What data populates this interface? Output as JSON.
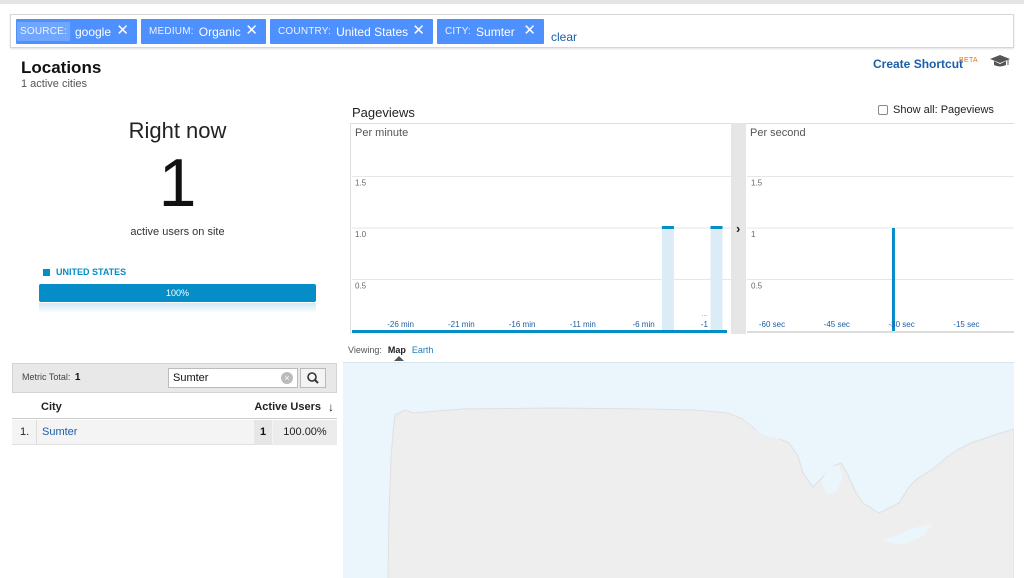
{
  "filters": {
    "chips": [
      {
        "key": "SOURCE:",
        "value": "google"
      },
      {
        "key": "MEDIUM:",
        "value": "Organic"
      },
      {
        "key": "COUNTRY:",
        "value": "United States"
      },
      {
        "key": "CITY:",
        "value": "Sumter"
      }
    ],
    "close_glyph": "✕",
    "clear_label": "clear"
  },
  "header": {
    "title": "Locations",
    "subtitle": "1 active cities",
    "shortcut_label": "Create Shortcut",
    "beta_label": "BETA",
    "cap_icon": "graduation-cap-icon"
  },
  "right_now": {
    "label": "Right now",
    "value": "1",
    "caption": "active users on site",
    "country": "UNITED STATES",
    "country_share_label": "100%",
    "country_share": 1.0
  },
  "pageviews": {
    "title": "Pageviews",
    "show_all_label": "Show all: Pageviews",
    "toggle_glyph": "›",
    "per_minute": {
      "label": "Per minute",
      "y_ticks": [
        "1.5",
        "1.0",
        "0.5"
      ],
      "x_ticks": [
        "-26 min",
        "-21 min",
        "-16 min",
        "-11 min",
        "-6 min",
        "-1"
      ],
      "overflow_marker": "...",
      "bars": [
        {
          "minute": -4,
          "value": 1
        },
        {
          "minute": 0,
          "value": 1
        }
      ]
    },
    "per_second": {
      "label": "Per second",
      "y_ticks": [
        "1.5",
        "1",
        "0.5"
      ],
      "x_ticks": [
        "-60 sec",
        "-45 sec",
        "-30 sec",
        "-15 sec"
      ],
      "bars": [
        {
          "second": -32,
          "value": 1
        }
      ]
    },
    "color": "#058dc7"
  },
  "viewing": {
    "label": "Viewing:",
    "options": [
      {
        "label": "Map",
        "active": true
      },
      {
        "label": "Earth",
        "active": false
      }
    ]
  },
  "table": {
    "metric_total_label": "Metric Total:",
    "metric_total_value": "1",
    "search_value": "Sumter",
    "columns": [
      "City",
      "Active Users"
    ],
    "sort_glyph": "↓",
    "rows": [
      {
        "index": "1.",
        "city": "Sumter",
        "users": "1",
        "percent": "100.00%"
      }
    ]
  }
}
